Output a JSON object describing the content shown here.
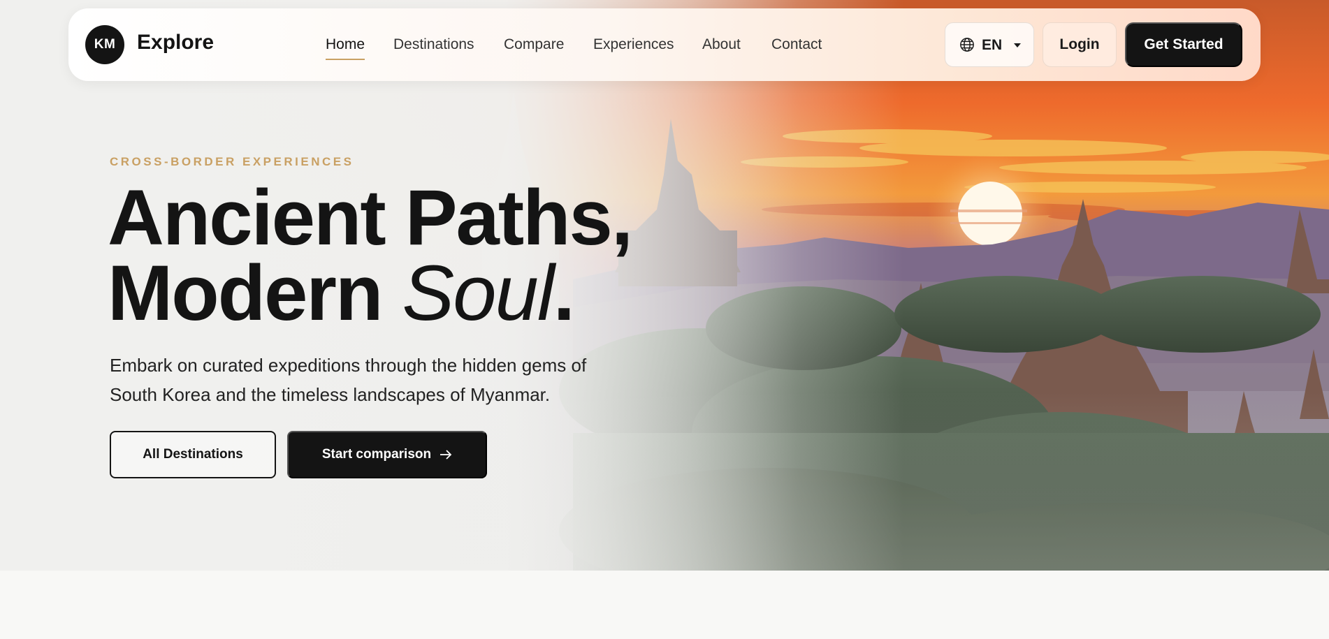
{
  "brand": {
    "monogram": "KM",
    "name": "Explore"
  },
  "nav": {
    "links": [
      {
        "label": "Home",
        "active": true
      },
      {
        "label": "Destinations",
        "active": false
      },
      {
        "label": "Compare",
        "active": false
      },
      {
        "label": "Experiences",
        "active": false
      },
      {
        "label": "About",
        "active": false
      },
      {
        "label": "Contact",
        "active": false
      }
    ],
    "language": "EN",
    "login_label": "Login",
    "cta_label": "Get Started"
  },
  "hero": {
    "eyebrow": "CROSS-BORDER EXPERIENCES",
    "headline_line1": "Ancient Paths,",
    "headline_line2_plain": "Modern ",
    "headline_line2_italic": "Soul",
    "headline_line2_end": ".",
    "subtext": "Embark on curated expeditions through the hidden gems of South Korea and the timeless landscapes of Myanmar.",
    "primary_button": "All Destinations",
    "secondary_button": "Start comparison",
    "secondary_button_icon": "arrow-right-icon",
    "background_image": "bagan-temples-sunset"
  },
  "colors": {
    "accent_gold": "#c9a063",
    "dark": "#141414",
    "page_background": "#f8f8f6"
  }
}
